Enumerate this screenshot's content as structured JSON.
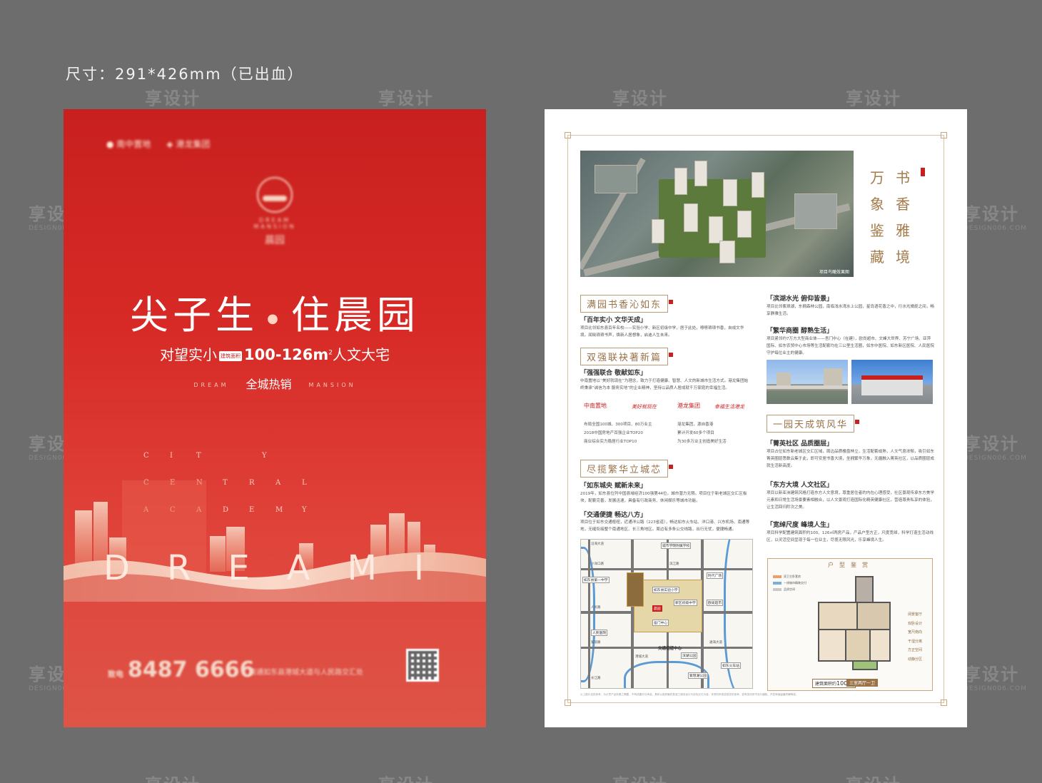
{
  "canvas_label": "尺寸：291*426mm（已出血）",
  "watermarks": {
    "cn": "享设计",
    "en": "DESIGN006.COM"
  },
  "front": {
    "developer_logos": [
      "● 南中置地",
      "◈ 港龙集团"
    ],
    "emblem_en": "DREAM MANSION",
    "emblem_cn": "晨园",
    "headline_left": "尖子生",
    "headline_dot": "●",
    "headline_right": "住晨园",
    "sub_prefix": "对望实小",
    "sub_tag": "建筑面积",
    "sub_area": "100-126m",
    "sub_sup": "2",
    "sub_suffix": "人文大宅",
    "hot_left": "DREAM",
    "hot": "全城热销",
    "hot_right": "MANSION",
    "city_rows": [
      [
        "C",
        "I",
        "T",
        "Y"
      ],
      [
        "C",
        "E",
        "N",
        "T",
        "R",
        "A",
        "L"
      ],
      [
        "A",
        "C",
        "A",
        "D",
        "E",
        "M",
        "Y"
      ]
    ],
    "dream": "DREAMI",
    "phone_label": "致电",
    "phone": "8487 6666",
    "address": "南通如东县港城大道与人民路交汇处",
    "colors": {
      "primary": "#c8201f",
      "gold": "#f7d6c2"
    }
  },
  "back": {
    "vertical_right": [
      "书",
      "香",
      "雅",
      "境"
    ],
    "vertical_left": [
      "万",
      "象",
      "鉴",
      "藏"
    ],
    "aerial_caption": "项目鸟瞰效果图",
    "sections_left": [
      {
        "title": "满园书香沁如东",
        "items": [
          {
            "head": "「百年实小 文华天成」",
            "body": "项目比邻如东县百年名校——实验小学、新区初级中学，居于此处，嘹嘹琅琅书香，自成文华境。闻晓琅琅书声，焕新人居想象，启迪人生未来。"
          }
        ]
      },
      {
        "title": "双强联袂著新篇",
        "items": [
          {
            "head": "「强强联合 敬献如东」",
            "body": "中南置地以“美好就现在”为理念，致力于打造健康、智慧、人文的新城市生活方式。港龙集团始终秉承“诚信为本 服务实地”的企业精神，坚持以品质人居成就千万家庭的幸福生活。"
          }
        ]
      },
      {
        "title": "尽揽繁华立城芯",
        "items": [
          {
            "head": "「如东城央 赋新未来」",
            "body": "2019年，如东县位列中国县域经济100强第44位，城市潜力无限。项目位于新老城区交汇区板块，配套完善，发展迅速，具备有行政商务、休闲娱乐等城市功能。"
          },
          {
            "head": "「交通便捷 畅达八方」",
            "body": "项目位于如东交通枢纽，近通洋公路（223省道），畅达如东火车站、洋口港、兴东机场、南通等地，无缝衔接整个南通地区、长三角地区。周边有多条公交线路，出行无忧，便捷畅通。"
          }
        ]
      }
    ],
    "brands": {
      "a_name": "中南置地",
      "a_sig": "美好就现在",
      "a_lines": [
        "布局全国100城、300项目、80万业主",
        "2018中国房地产百强企业TOP20",
        "商业综合实力稳居行业TOP10"
      ],
      "b_name": "港龙集团",
      "b_sig": "幸福生活港龙",
      "b_lines": [
        "港龙集团，源自香港",
        "累计开发60多个项目",
        "为30多万业主创造美好生活"
      ]
    },
    "sections_right": [
      {
        "items": [
          {
            "head": "「滨湖水光 俯仰皆景」",
            "body": "项目比邻紫琅湖，东拥森林公园，南临浅水湾水上公园，星岛语花香之中，行水光旖旎之间，畅享静雅生活。"
          },
          {
            "head": "「繁华商圈 醇熟生活」",
            "body": "项目紧邻约7万方大型商业体——吾门中心（在建），欧尚超市、文峰大世界、苏宁广场、亚萍国际、如东农贸中心市场等生活配套均在三公里生活圈，如东中医院、如东新区医院、人民医院守护每位业主的健康。"
          }
        ]
      },
      {
        "title": "一园天成筑风华",
        "items": [
          {
            "head": "「菁英社区 品质圈层」",
            "body": "项目占位如东新老城区交汇区域，周边品质楼盘林立，生活配套成熟，人文气息浓郁，吸引如东菁英圈层悉数云集于此，即可安居书香大境，坐拥繁华万象，无疆融入菁英社区，以品质圈层成就生活新高度。"
          },
          {
            "head": "「东方大境 人文社区」",
            "body": "项目以新亚洲建筑风格打造东方人文意境，尊重居住者的内在心理感受，社区景观传承东方美学元素和日常生活场景要素相融合，以人文景观打造国际化精英健康社区，营造尊贵私享的体验，让生活回归阶次之美。"
          },
          {
            "head": "「宽绰尺度 峰境人生」",
            "body": "项目科学配置建筑面积约100、126㎡两房产品，产品户型方正，尺度宽绰，科学打造生活动线区，以灵活空间呈现于每一位业主，尽揽无限风光，乐享峰境人生。"
          }
        ]
      }
    ],
    "map": {
      "center": "晨园",
      "labels": [
        "城市学院附属学校",
        "如东县第一中学",
        "如东县实验小学",
        "新区初级中学",
        "时代广场",
        "欧尚超市",
        "人民医院",
        "吾门中心",
        "滨湖公园",
        "紫琅湖公园",
        "如东火车站"
      ],
      "roads": [
        "沿海大道",
        "人民路",
        "通海大道",
        "港城大道",
        "小洋口路",
        "紫琅路",
        "滨江路",
        "长江路"
      ],
      "hub": "交通枢纽中心"
    },
    "plan": {
      "title": "户型鉴赏",
      "legend": [
        "双卫主卧套房",
        "一线城市精装交付",
        "品质空间"
      ],
      "features": [
        "阔景客厅",
        "双卧设计",
        "宽尺南向",
        "干湿分离",
        "方正空间",
        "动静分区"
      ],
      "area_label": "建筑面积约",
      "area_value": "100㎡",
      "type_label": "三室两厅一卫"
    },
    "footnote": "以上图片仅供参考，为示意产品效果之需要，不构成要约与承诺。具体以政府最终批准之规划设计与实际交付为准。本资料所述信息仅供参考，如有变动恕不另行通知。开发商保留最终解释权。"
  }
}
